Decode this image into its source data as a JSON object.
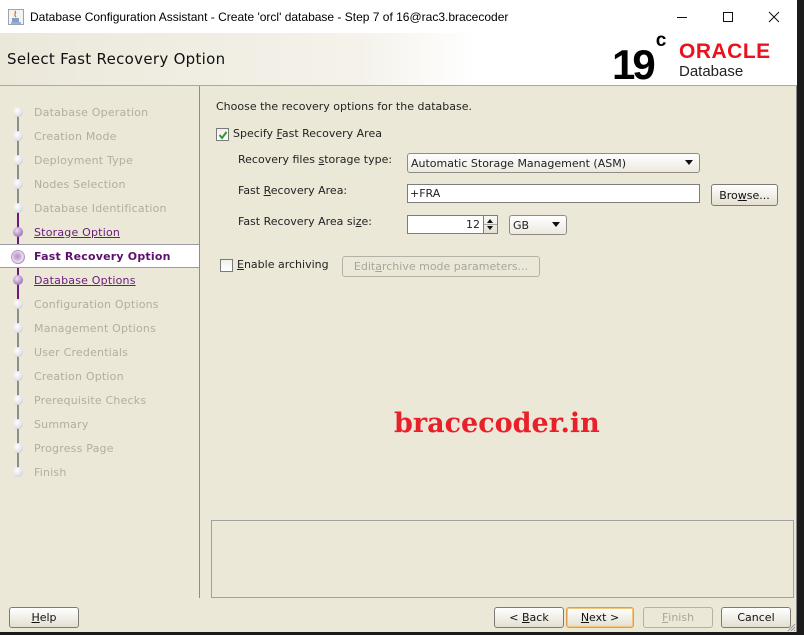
{
  "window": {
    "title": "Database Configuration Assistant - Create 'orcl' database - Step 7 of 16@rac3.bracecoder",
    "controls": {
      "minimize": "—",
      "maximize": "☐",
      "close": "✕"
    }
  },
  "header": {
    "page_title": "Select Fast Recovery Option",
    "logo": {
      "version": "19",
      "version_suffix": "c",
      "brand": "ORACLE",
      "product": "Database",
      "brand_color": "#e8131d"
    }
  },
  "sidebar": {
    "steps": [
      {
        "label": "Database Operation",
        "state": "pending"
      },
      {
        "label": "Creation Mode",
        "state": "pending"
      },
      {
        "label": "Deployment Type",
        "state": "pending"
      },
      {
        "label": "Nodes Selection",
        "state": "pending"
      },
      {
        "label": "Database Identification",
        "state": "pending"
      },
      {
        "label": "Storage Option",
        "state": "done"
      },
      {
        "label": "Fast Recovery Option",
        "state": "current"
      },
      {
        "label": "Database Options",
        "state": "done"
      },
      {
        "label": "Configuration Options",
        "state": "pending"
      },
      {
        "label": "Management Options",
        "state": "pending"
      },
      {
        "label": "User Credentials",
        "state": "pending"
      },
      {
        "label": "Creation Option",
        "state": "pending"
      },
      {
        "label": "Prerequisite Checks",
        "state": "pending"
      },
      {
        "label": "Summary",
        "state": "pending"
      },
      {
        "label": "Progress Page",
        "state": "pending"
      },
      {
        "label": "Finish",
        "state": "pending"
      }
    ],
    "active_color": "#5d0f6e"
  },
  "content": {
    "intro": "Choose the recovery options for the database.",
    "specify_fra": {
      "label_pre": "Specify ",
      "label_mn": "F",
      "label_post": "ast Recovery Area",
      "checked": true
    },
    "storage_type": {
      "label_pre": "Recovery files ",
      "label_mn": "s",
      "label_post": "torage type:",
      "value": "Automatic Storage Management (ASM)"
    },
    "fra_location": {
      "label_pre": "Fast ",
      "label_mn": "R",
      "label_post": "ecovery Area:",
      "value": "+FRA",
      "browse_pre": "Bro",
      "browse_mn": "w",
      "browse_post": "se..."
    },
    "fra_size": {
      "label_pre": "Fast Recovery Area si",
      "label_mn": "z",
      "label_post": "e:",
      "value": "12",
      "unit": "GB"
    },
    "archiving": {
      "label_mn": "E",
      "label_post": "nable archiving",
      "checked": false,
      "edit_pre": "Edit ",
      "edit_mn": "a",
      "edit_post": "rchive mode parameters..."
    },
    "watermark": "bracecoder.in",
    "watermark_color": "#e8202a"
  },
  "footer": {
    "help": {
      "mn": "H",
      "post": "elp"
    },
    "back": {
      "pre": "< ",
      "mn": "B",
      "post": "ack"
    },
    "next": {
      "mn": "N",
      "post": "ext >"
    },
    "finish": {
      "mn": "F",
      "post": "inish",
      "enabled": false
    },
    "cancel": "Cancel"
  }
}
